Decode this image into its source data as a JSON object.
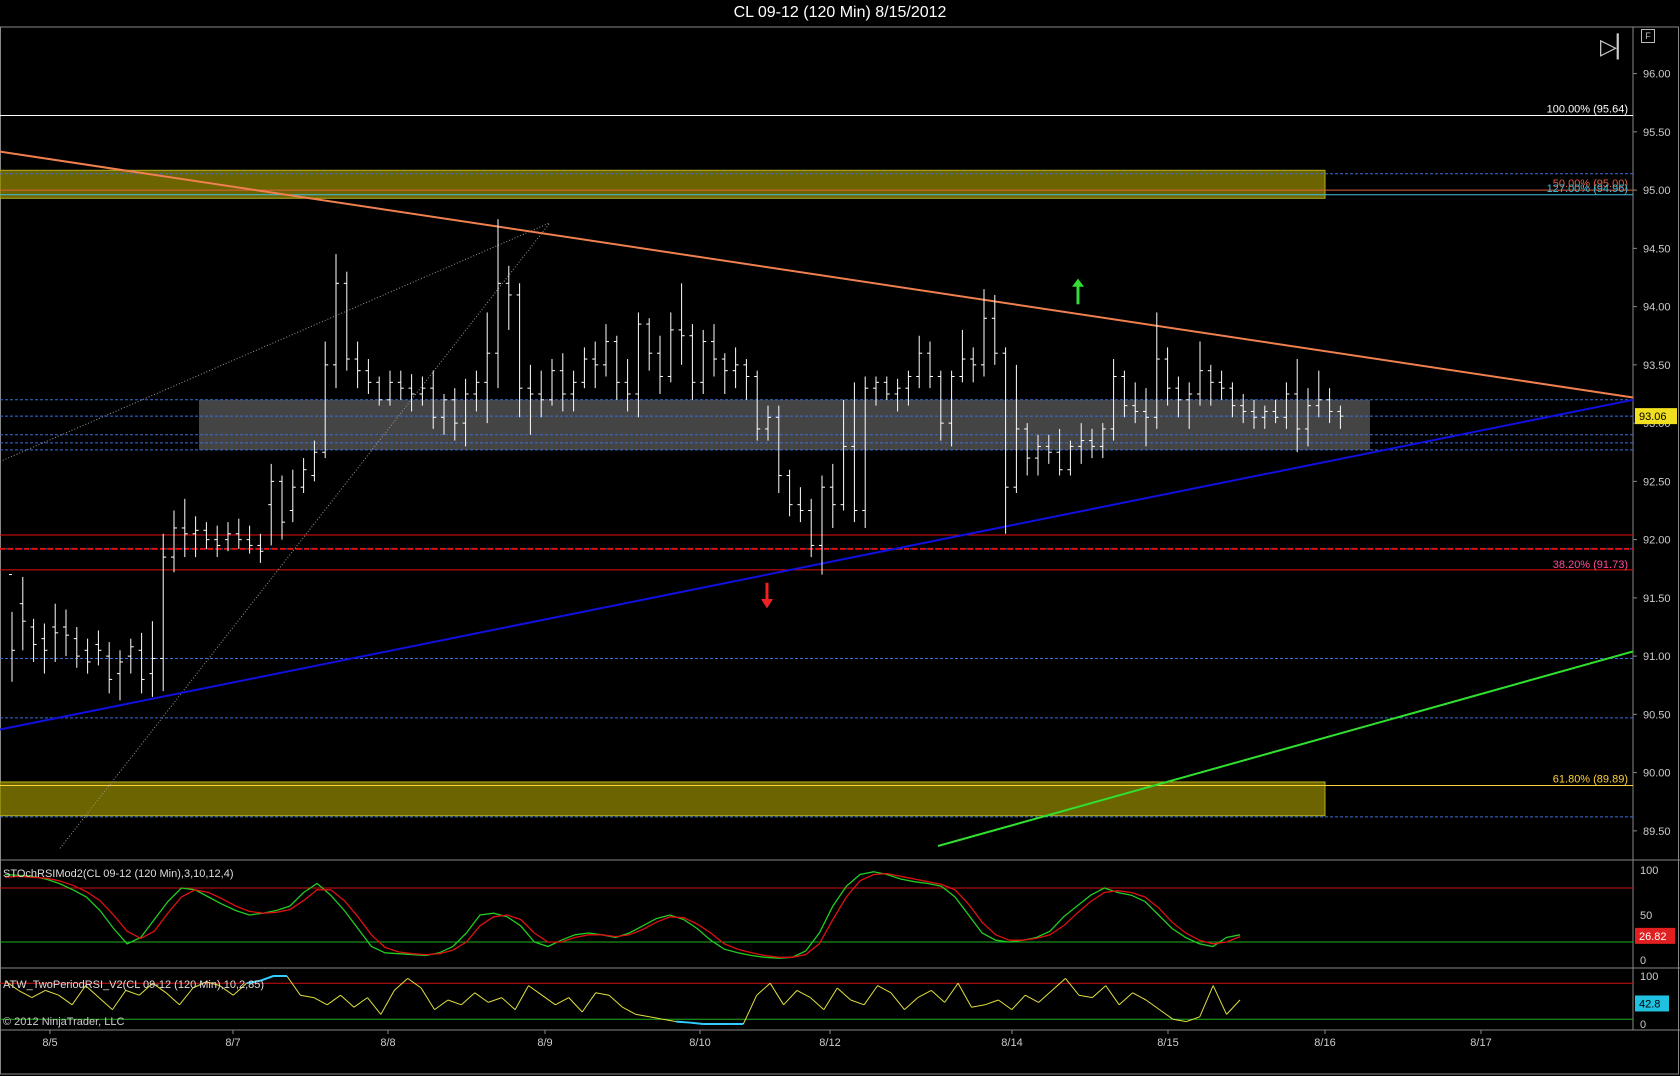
{
  "window": {
    "title": "CL 09-12 (120 Min)  8/15/2012"
  },
  "copyright": "© 2012 NinjaTrader, LLC",
  "colors": {
    "background": "#000000",
    "bars": "#ffffff",
    "resistance_trend": "#f08050",
    "support_trend": "#1010e0",
    "green_trend": "#30e030",
    "zone_fill": "#6b6400",
    "consolidation_box": "#555555",
    "stoch_k": "#22cc22",
    "stoch_d": "#dd1111",
    "rsi_line": "#e0e040",
    "rsi_extreme": "#33ccff"
  },
  "icons": {
    "playback": "skip-to-end-icon",
    "f_box": "F"
  },
  "chart_data": [
    {
      "type": "ohlc",
      "instrument": "CL 09-12",
      "interval": "120 Min",
      "ylim": [
        89.25,
        96.4
      ],
      "y_ticks": [
        "96.00",
        "95.50",
        "95.00",
        "94.50",
        "94.00",
        "93.50",
        "93.00",
        "92.50",
        "92.00",
        "91.50",
        "91.00",
        "90.50",
        "90.00",
        "89.50"
      ],
      "x_labels": [
        "8/5",
        "8/7",
        "8/8",
        "8/9",
        "8/10",
        "8/12",
        "8/14",
        "8/15",
        "8/16",
        "8/17"
      ],
      "last_price": "93.06",
      "fib_labels": [
        {
          "text": "100.00% (95.64)",
          "price": 95.64,
          "color": "#ffffff"
        },
        {
          "text": "50.00% (95.00)",
          "price": 95.0,
          "color": "#e06040"
        },
        {
          "text": "127.00% (94.96)",
          "price": 94.96,
          "color": "#40c0e0"
        },
        {
          "text": "38.20% (91.73)",
          "price": 91.73,
          "color": "#ff4a9a"
        },
        {
          "text": "61.80% (89.89)",
          "price": 89.89,
          "color": "#ffd23a"
        }
      ],
      "dashed_levels": [
        95.14,
        93.2,
        93.06,
        92.9,
        92.83,
        92.77,
        91.92,
        90.98,
        90.47,
        89.62
      ],
      "red_levels": [
        92.04,
        91.92,
        91.74
      ],
      "zones": [
        {
          "from": 94.93,
          "to": 95.17,
          "x_end": "8/16"
        },
        {
          "from": 89.63,
          "to": 89.92,
          "x_end": "8/16"
        }
      ],
      "consolidation": {
        "from": 92.77,
        "to": 93.2
      },
      "bars": [
        [
          91.7,
          91.38,
          90.78,
          91.05
        ],
        [
          91.45,
          91.68,
          91.05,
          91.3
        ],
        [
          91.25,
          91.32,
          90.95,
          91.1
        ],
        [
          91.15,
          91.28,
          90.85,
          91.05
        ],
        [
          91.25,
          91.45,
          90.95,
          91.2
        ],
        [
          91.25,
          91.4,
          91.0,
          91.18
        ],
        [
          91.15,
          91.25,
          90.9,
          91.0
        ],
        [
          91.05,
          91.15,
          90.85,
          90.95
        ],
        [
          91.1,
          91.22,
          90.92,
          91.05
        ],
        [
          91.0,
          91.12,
          90.68,
          90.8
        ],
        [
          90.85,
          91.05,
          90.62,
          90.95
        ],
        [
          91.0,
          91.15,
          90.85,
          91.08
        ],
        [
          91.05,
          91.2,
          90.68,
          90.8
        ],
        [
          90.85,
          91.3,
          90.65,
          90.98
        ],
        [
          90.98,
          92.05,
          90.7,
          91.85
        ],
        [
          91.85,
          92.25,
          91.72,
          92.1
        ],
        [
          92.1,
          92.35,
          91.85,
          92.05
        ],
        [
          92.05,
          92.2,
          91.85,
          92.08
        ],
        [
          92.08,
          92.15,
          91.92,
          92.0
        ],
        [
          92.0,
          92.12,
          91.85,
          91.95
        ],
        [
          92.0,
          92.15,
          91.9,
          92.05
        ],
        [
          92.05,
          92.18,
          91.92,
          92.0
        ],
        [
          92.0,
          92.12,
          91.88,
          91.95
        ],
        [
          91.95,
          92.05,
          91.8,
          91.9
        ],
        [
          92.3,
          92.65,
          91.95,
          92.5
        ],
        [
          92.5,
          92.55,
          92.0,
          92.15
        ],
        [
          92.25,
          92.6,
          92.15,
          92.45
        ],
        [
          92.45,
          92.7,
          92.4,
          92.6
        ],
        [
          92.55,
          92.85,
          92.5,
          92.75
        ],
        [
          92.75,
          93.7,
          92.7,
          93.5
        ],
        [
          93.5,
          94.45,
          93.3,
          94.2
        ],
        [
          94.2,
          94.3,
          93.45,
          93.55
        ],
        [
          93.55,
          93.7,
          93.3,
          93.45
        ],
        [
          93.45,
          93.55,
          93.25,
          93.35
        ],
        [
          93.35,
          93.4,
          93.15,
          93.2
        ],
        [
          93.2,
          93.45,
          93.15,
          93.35
        ],
        [
          93.35,
          93.45,
          93.2,
          93.3
        ],
        [
          93.3,
          93.42,
          93.1,
          93.25
        ],
        [
          93.25,
          93.4,
          93.15,
          93.3
        ],
        [
          93.3,
          93.45,
          92.95,
          93.05
        ],
        [
          93.05,
          93.25,
          92.9,
          93.2
        ],
        [
          93.2,
          93.3,
          92.85,
          93.0
        ],
        [
          93.0,
          93.38,
          92.8,
          93.25
        ],
        [
          93.25,
          93.45,
          93.1,
          93.35
        ],
        [
          93.35,
          93.95,
          93.0,
          93.6
        ],
        [
          93.6,
          94.75,
          93.3,
          94.2
        ],
        [
          94.2,
          94.35,
          93.8,
          94.1
        ],
        [
          94.1,
          94.2,
          93.05,
          93.3
        ],
        [
          93.3,
          93.5,
          92.9,
          93.25
        ],
        [
          93.25,
          93.45,
          93.05,
          93.2
        ],
        [
          93.2,
          93.55,
          93.15,
          93.45
        ],
        [
          93.45,
          93.6,
          93.1,
          93.25
        ],
        [
          93.25,
          93.45,
          93.1,
          93.35
        ],
        [
          93.35,
          93.65,
          93.3,
          93.55
        ],
        [
          93.55,
          93.7,
          93.3,
          93.5
        ],
        [
          93.5,
          93.85,
          93.4,
          93.7
        ],
        [
          93.7,
          93.75,
          93.2,
          93.35
        ],
        [
          93.35,
          93.55,
          93.1,
          93.25
        ],
        [
          93.25,
          93.95,
          93.05,
          93.85
        ],
        [
          93.85,
          93.9,
          93.45,
          93.6
        ],
        [
          93.6,
          93.75,
          93.25,
          93.4
        ],
        [
          93.4,
          93.95,
          93.35,
          93.8
        ],
        [
          93.8,
          94.2,
          93.5,
          93.75
        ],
        [
          93.75,
          93.85,
          93.2,
          93.35
        ],
        [
          93.35,
          93.8,
          93.25,
          93.7
        ],
        [
          93.7,
          93.85,
          93.4,
          93.55
        ],
        [
          93.55,
          93.6,
          93.25,
          93.45
        ],
        [
          93.45,
          93.65,
          93.3,
          93.5
        ],
        [
          93.5,
          93.55,
          93.2,
          93.4
        ],
        [
          93.4,
          93.45,
          92.85,
          92.95
        ],
        [
          92.95,
          93.15,
          92.85,
          93.05
        ],
        [
          93.05,
          93.15,
          92.4,
          92.55
        ],
        [
          92.55,
          92.6,
          92.2,
          92.3
        ],
        [
          92.3,
          92.45,
          92.15,
          92.25
        ],
        [
          92.25,
          92.35,
          91.85,
          91.95
        ],
        [
          91.95,
          92.55,
          91.7,
          92.45
        ],
        [
          92.45,
          92.65,
          92.1,
          92.3
        ],
        [
          92.3,
          93.2,
          92.25,
          92.8
        ],
        [
          92.8,
          93.35,
          92.15,
          92.25
        ],
        [
          92.25,
          93.4,
          92.1,
          93.3
        ],
        [
          93.3,
          93.4,
          93.15,
          93.35
        ],
        [
          93.35,
          93.4,
          93.2,
          93.25
        ],
        [
          93.25,
          93.38,
          93.1,
          93.3
        ],
        [
          93.3,
          93.45,
          93.15,
          93.4
        ],
        [
          93.4,
          93.75,
          93.3,
          93.6
        ],
        [
          93.6,
          93.7,
          93.3,
          93.4
        ],
        [
          93.4,
          93.45,
          92.85,
          93.0
        ],
        [
          93.0,
          93.45,
          92.8,
          93.4
        ],
        [
          93.4,
          93.8,
          93.35,
          93.55
        ],
        [
          93.55,
          93.65,
          93.35,
          93.5
        ],
        [
          93.5,
          94.15,
          93.4,
          93.9
        ],
        [
          93.9,
          94.1,
          93.5,
          93.6
        ],
        [
          93.6,
          93.65,
          92.05,
          92.45
        ],
        [
          92.45,
          93.5,
          92.4,
          92.95
        ],
        [
          92.95,
          93.0,
          92.55,
          92.7
        ],
        [
          92.7,
          92.9,
          92.55,
          92.8
        ],
        [
          92.8,
          92.9,
          92.65,
          92.75
        ],
        [
          92.75,
          92.95,
          92.55,
          92.6
        ],
        [
          92.6,
          92.85,
          92.55,
          92.8
        ],
        [
          92.8,
          93.0,
          92.65,
          92.85
        ],
        [
          92.85,
          92.95,
          92.7,
          92.8
        ],
        [
          92.8,
          93.0,
          92.7,
          92.95
        ],
        [
          92.95,
          93.55,
          92.85,
          93.4
        ],
        [
          93.4,
          93.45,
          93.05,
          93.15
        ],
        [
          93.15,
          93.35,
          93.0,
          93.1
        ],
        [
          93.1,
          93.3,
          92.8,
          93.05
        ],
        [
          93.05,
          93.95,
          92.95,
          93.55
        ],
        [
          93.55,
          93.65,
          93.15,
          93.3
        ],
        [
          93.3,
          93.4,
          93.05,
          93.2
        ],
        [
          93.2,
          93.35,
          92.95,
          93.25
        ],
        [
          93.25,
          93.7,
          93.15,
          93.45
        ],
        [
          93.45,
          93.5,
          93.15,
          93.35
        ],
        [
          93.35,
          93.45,
          93.2,
          93.3
        ],
        [
          93.3,
          93.35,
          93.05,
          93.15
        ],
        [
          93.15,
          93.25,
          93.0,
          93.1
        ],
        [
          93.1,
          93.2,
          92.95,
          93.05
        ],
        [
          93.05,
          93.15,
          92.95,
          93.1
        ],
        [
          93.1,
          93.2,
          93.0,
          93.05
        ],
        [
          93.05,
          93.35,
          92.95,
          93.25
        ],
        [
          93.25,
          93.55,
          92.75,
          92.95
        ],
        [
          92.95,
          93.3,
          92.8,
          93.15
        ],
        [
          93.15,
          93.45,
          93.05,
          93.2
        ],
        [
          93.2,
          93.3,
          93.0,
          93.1
        ],
        [
          93.1,
          93.15,
          92.95,
          93.06
        ]
      ],
      "annotations": [
        {
          "type": "arrow-up",
          "label": "",
          "color": "#33dd33"
        },
        {
          "type": "arrow-down",
          "label": "",
          "color": "#ee2222"
        }
      ]
    },
    {
      "type": "line",
      "title": "STOchRSIMod2(CL 09-12 (120 Min),3,10,12,4)",
      "ylim": [
        0,
        100
      ],
      "y_ticks": [
        "100",
        "50",
        "0"
      ],
      "upper_level": 80,
      "lower_level": 20,
      "last_value": "26.82",
      "series": [
        {
          "values": [
            95,
            94,
            93,
            90,
            85,
            78,
            70,
            55,
            35,
            18,
            25,
            45,
            65,
            80,
            78,
            70,
            62,
            55,
            50,
            52,
            55,
            60,
            75,
            85,
            72,
            55,
            35,
            15,
            8,
            7,
            6,
            5,
            8,
            15,
            30,
            50,
            52,
            48,
            38,
            20,
            15,
            22,
            28,
            30,
            28,
            25,
            30,
            38,
            46,
            50,
            45,
            35,
            22,
            12,
            8,
            5,
            3,
            2,
            3,
            10,
            30,
            60,
            82,
            95,
            98,
            95,
            90,
            87,
            85,
            82,
            70,
            50,
            30,
            22,
            20,
            22,
            25,
            32,
            48,
            60,
            72,
            80,
            75,
            72,
            65,
            50,
            35,
            25,
            18,
            15,
            25,
            28
          ]
        },
        {
          "values": [
            92,
            93,
            92,
            91,
            88,
            83,
            76,
            66,
            50,
            32,
            24,
            32,
            52,
            70,
            78,
            75,
            68,
            60,
            54,
            52,
            53,
            56,
            66,
            78,
            78,
            66,
            48,
            28,
            14,
            9,
            7,
            6,
            7,
            11,
            20,
            38,
            48,
            50,
            45,
            30,
            20,
            20,
            25,
            28,
            28,
            26,
            28,
            34,
            42,
            48,
            47,
            40,
            30,
            18,
            12,
            8,
            5,
            3,
            3,
            6,
            18,
            45,
            70,
            88,
            95,
            96,
            93,
            90,
            87,
            84,
            78,
            62,
            42,
            28,
            22,
            22,
            24,
            28,
            38,
            52,
            65,
            75,
            77,
            75,
            70,
            58,
            42,
            30,
            22,
            18,
            20,
            26
          ]
        }
      ]
    },
    {
      "type": "line",
      "title": "ATW_TwoPeriodRSI_V2(CL 09-12 (120 Min),10,2,85)",
      "ylim": [
        0,
        100
      ],
      "y_ticks": [
        "100",
        "50",
        "0"
      ],
      "upper_level": 85,
      "lower_level": 10,
      "last_value": "42.8",
      "series": [
        {
          "values": [
            90,
            70,
            55,
            70,
            60,
            40,
            80,
            55,
            30,
            70,
            60,
            85,
            65,
            40,
            75,
            88,
            80,
            60,
            85,
            90,
            100,
            100,
            60,
            55,
            40,
            60,
            35,
            55,
            20,
            70,
            95,
            75,
            30,
            50,
            40,
            65,
            45,
            55,
            30,
            80,
            60,
            40,
            55,
            25,
            65,
            60,
            35,
            20,
            15,
            10,
            5,
            3,
            0,
            0,
            0,
            0,
            60,
            85,
            40,
            70,
            55,
            30,
            75,
            50,
            40,
            80,
            65,
            30,
            55,
            70,
            45,
            85,
            35,
            40,
            50,
            30,
            60,
            45,
            70,
            95,
            60,
            55,
            80,
            40,
            65,
            50,
            30,
            10,
            5,
            15,
            80,
            20,
            50
          ]
        }
      ]
    }
  ]
}
